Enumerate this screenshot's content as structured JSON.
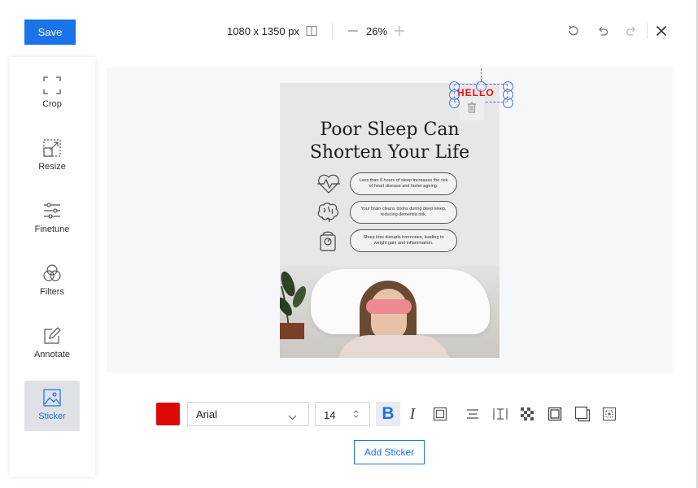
{
  "header": {
    "save_label": "Save",
    "dimensions": "1080 x 1350 px",
    "zoom": "26%"
  },
  "sidebar": {
    "items": [
      {
        "label": "Crop",
        "icon": "crop-icon"
      },
      {
        "label": "Resize",
        "icon": "resize-icon"
      },
      {
        "label": "Finetune",
        "icon": "finetune-icon"
      },
      {
        "label": "Filters",
        "icon": "filters-icon"
      },
      {
        "label": "Annotate",
        "icon": "annotate-icon"
      },
      {
        "label": "Sticker",
        "icon": "sticker-icon",
        "active": true
      }
    ]
  },
  "poster": {
    "title_line1": "Poor Sleep Can",
    "title_line2": "Shorten Your Life",
    "rows": [
      {
        "icon": "heart-pulse-icon",
        "text": "Less than 6 hours of sleep increases the risk of heart disease and faster ageing."
      },
      {
        "icon": "brain-icon",
        "text": "Your brain cleans toxins during deep sleep, reducing dementia risk."
      },
      {
        "icon": "scale-icon",
        "text": "Sleep loss disrupts hormones, leading to weight gain and inflammation."
      }
    ],
    "sticker_text": "HELLO"
  },
  "toolbar": {
    "color": "#dd0a0a",
    "font": "Arial",
    "font_size": "14",
    "add_sticker_label": "Add Sticker"
  },
  "colors": {
    "accent": "#1a73e8",
    "selection": "#4a6fe0"
  }
}
